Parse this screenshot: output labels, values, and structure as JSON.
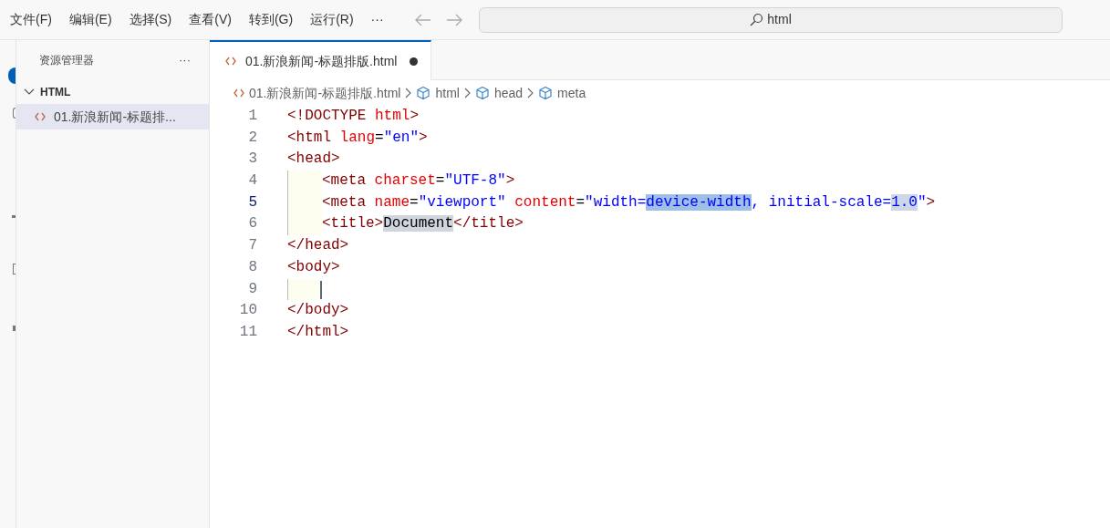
{
  "menu": [
    "文件(F)",
    "编辑(E)",
    "选择(S)",
    "查看(V)",
    "转到(G)",
    "运行(R)",
    "···"
  ],
  "search": {
    "value": "html"
  },
  "explorer": {
    "title": "资源管理器",
    "more": "···",
    "folder": {
      "label": "HTML",
      "expanded": true,
      "children": [
        {
          "label": "01.新浪新闻-标题排...",
          "selected": true
        }
      ]
    }
  },
  "tabs": [
    {
      "label": "01.新浪新闻-标题排版.html",
      "selected": true,
      "modified": true
    }
  ],
  "breadcrumbs": [
    {
      "kind": "file",
      "label": "01.新浪新闻-标题排版.html"
    },
    {
      "kind": "element",
      "label": "html"
    },
    {
      "kind": "element",
      "label": "head"
    },
    {
      "kind": "element",
      "label": "meta"
    }
  ],
  "lines": [
    {
      "number": "1",
      "current": false,
      "indented": false,
      "cursor": false,
      "tokens": [
        {
          "kind": "tag",
          "text": "<!DOCTYPE "
        },
        {
          "kind": "attr",
          "text": "html"
        },
        {
          "kind": "tag",
          "text": ">"
        }
      ]
    },
    {
      "number": "2",
      "current": false,
      "indented": false,
      "cursor": false,
      "tokens": [
        {
          "kind": "tag",
          "text": "<html "
        },
        {
          "kind": "attr",
          "text": "lang"
        },
        {
          "kind": "text",
          "text": "="
        },
        {
          "kind": "string",
          "text": "\"en\""
        },
        {
          "kind": "tag",
          "text": ">"
        }
      ]
    },
    {
      "number": "3",
      "current": false,
      "indented": false,
      "cursor": false,
      "tokens": [
        {
          "kind": "tag",
          "text": "<head>"
        }
      ]
    },
    {
      "number": "4",
      "current": false,
      "indented": true,
      "cursor": false,
      "tokens": [
        {
          "kind": "tag",
          "text": "<meta "
        },
        {
          "kind": "attr",
          "text": "charset"
        },
        {
          "kind": "text",
          "text": "="
        },
        {
          "kind": "string",
          "text": "\"UTF-8\""
        },
        {
          "kind": "tag",
          "text": ">"
        }
      ]
    },
    {
      "number": "5",
      "current": true,
      "indented": true,
      "cursor": false,
      "tokens": [
        {
          "kind": "tag",
          "text": "<meta "
        },
        {
          "kind": "attr",
          "text": "name"
        },
        {
          "kind": "text",
          "text": "="
        },
        {
          "kind": "string",
          "text": "\"viewport\" "
        },
        {
          "kind": "attr",
          "text": "content"
        },
        {
          "kind": "text",
          "text": "="
        },
        {
          "kind": "string",
          "text": "\"width="
        },
        {
          "kind": "selection",
          "text": "device-width"
        },
        {
          "kind": "string",
          "text": ", initial-scale="
        },
        {
          "kind": "match",
          "text": "1.0"
        },
        {
          "kind": "string",
          "text": "\""
        },
        {
          "kind": "tag",
          "text": ">"
        }
      ]
    },
    {
      "number": "6",
      "current": false,
      "indented": true,
      "cursor": false,
      "tokens": [
        {
          "kind": "tag",
          "text": "<title>"
        },
        {
          "kind": "occurrence",
          "text": "Document"
        },
        {
          "kind": "tag",
          "text": "</title>"
        }
      ]
    },
    {
      "number": "7",
      "current": false,
      "indented": false,
      "cursor": false,
      "tokens": [
        {
          "kind": "tag",
          "text": "</head>"
        }
      ]
    },
    {
      "number": "8",
      "current": false,
      "indented": false,
      "cursor": false,
      "tokens": [
        {
          "kind": "tag",
          "text": "<body>"
        }
      ]
    },
    {
      "number": "9",
      "current": false,
      "indented": true,
      "cursor": true
    },
    {
      "number": "10",
      "current": false,
      "indented": false,
      "cursor": false,
      "tokens": [
        {
          "kind": "tag",
          "text": "</body>"
        }
      ]
    },
    {
      "number": "11",
      "current": false,
      "indented": false,
      "cursor": false,
      "tokens": [
        {
          "kind": "tag",
          "text": "</html>"
        }
      ]
    }
  ]
}
